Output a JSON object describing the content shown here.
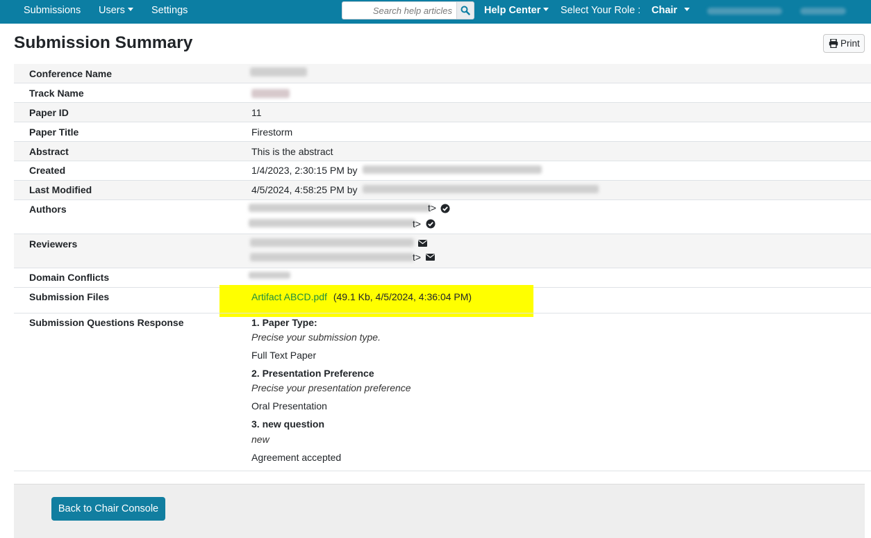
{
  "nav": {
    "submissions": "Submissions",
    "users": "Users",
    "settings": "Settings",
    "search_placeholder": "Search help articles",
    "help_center": "Help Center",
    "select_role_label": "Select Your Role :",
    "role": "Chair"
  },
  "page": {
    "title": "Submission Summary",
    "print_label": "Print"
  },
  "summary": {
    "conference_name_label": "Conference Name",
    "track_name_label": "Track Name",
    "paper_id_label": "Paper ID",
    "paper_id": "11",
    "paper_title_label": "Paper Title",
    "paper_title": "Firestorm",
    "abstract_label": "Abstract",
    "abstract": "This is the abstract",
    "created_label": "Created",
    "created": "1/4/2023, 2:30:15 PM by",
    "last_modified_label": "Last Modified",
    "last_modified": "4/5/2024, 4:58:25 PM by",
    "authors_label": "Authors",
    "author_suffix": "t>",
    "reviewers_label": "Reviewers",
    "reviewer_suffix": "t>",
    "domain_conflicts_label": "Domain Conflicts",
    "submission_files_label": "Submission Files",
    "file_name": "Artifact ABCD.pdf",
    "file_meta": "(49.1 Kb, 4/5/2024, 4:36:04 PM)",
    "questions_label": "Submission Questions Response"
  },
  "questions": [
    {
      "title": "1. Paper Type:",
      "description": "Precise your submission type.",
      "answer": "Full Text Paper"
    },
    {
      "title": "2. Presentation Preference",
      "description": "Precise your presentation preference",
      "answer": "Oral Presentation"
    },
    {
      "title": "3. new question",
      "description": "new",
      "answer": "Agreement accepted"
    }
  ],
  "footer": {
    "back_label": "Back to Chair Console"
  },
  "colors": {
    "navbar": "#0c7ea3",
    "highlight": "#ffff00",
    "link": "#1e8e3e",
    "button": "#117ea0"
  },
  "icons": [
    "search-icon",
    "print-icon",
    "check-circle-icon",
    "envelope-icon",
    "caret-down-icon"
  ]
}
